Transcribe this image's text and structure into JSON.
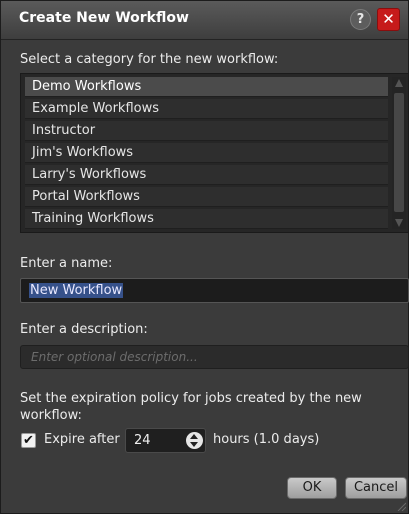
{
  "dialog": {
    "title": "Create New Workflow",
    "help_label": "?",
    "close_label": "✕"
  },
  "category": {
    "label": "Select a category for the new workflow:",
    "items": [
      "Demo Workflows",
      "Example Workflows",
      "Instructor",
      "Jim's Workflows",
      "Larry's Workflows",
      "Portal Workflows",
      "Training Workflows"
    ],
    "selected": "Demo Workflows"
  },
  "name": {
    "label": "Enter a name:",
    "value": "New Workflow"
  },
  "description": {
    "label": "Enter a description:",
    "placeholder": "Enter optional description..."
  },
  "expiration": {
    "label_line1": "Set the expiration policy for jobs created by the new",
    "label_line2": "workflow:",
    "checkbox_checked": true,
    "checkbox_label": "Expire after",
    "value": "24",
    "units": "hours (1.0 days)"
  },
  "buttons": {
    "ok": "OK",
    "cancel": "Cancel"
  },
  "colors": {
    "close_button": "#c61a1a",
    "selection": "#36518a",
    "background": "#3b3b3b"
  }
}
